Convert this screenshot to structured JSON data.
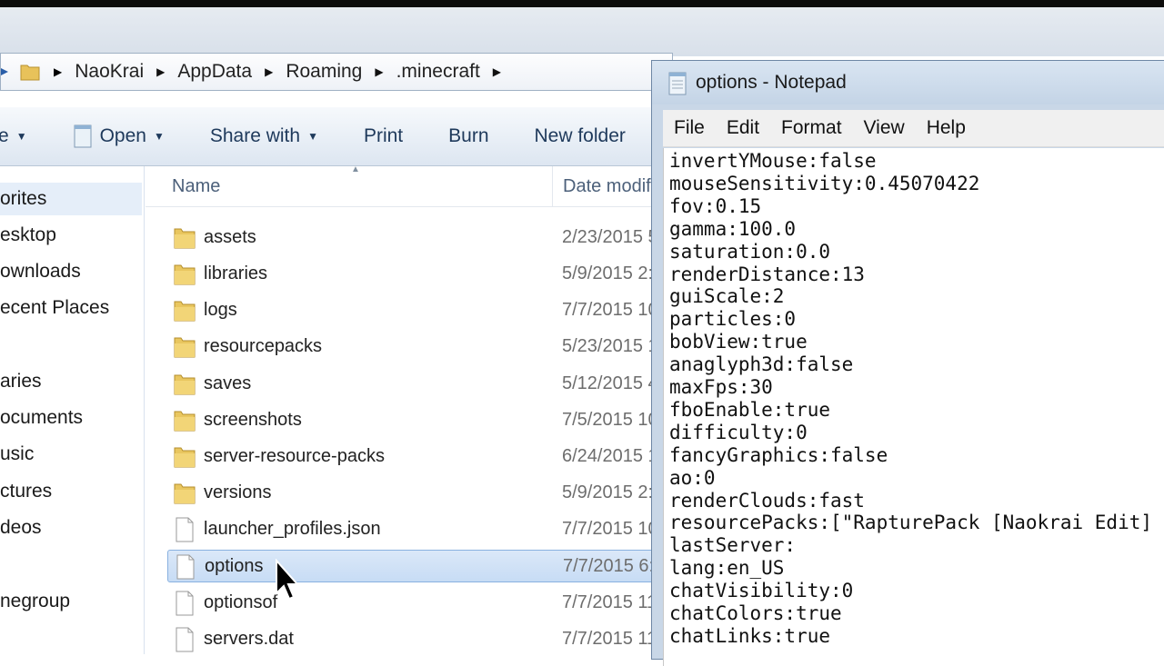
{
  "breadcrumb": [
    "NaoKrai",
    "AppData",
    "Roaming",
    ".minecraft"
  ],
  "toolbar": {
    "organize_partial": "e",
    "open_label": "Open",
    "share_label": "Share with",
    "print_label": "Print",
    "burn_label": "Burn",
    "new_folder_label": "New folder"
  },
  "nav": {
    "items": [
      "orites",
      "esktop",
      "ownloads",
      "ecent Places",
      "aries",
      "ocuments",
      "usic",
      "ctures",
      "deos",
      "negroup"
    ]
  },
  "columns": {
    "name": "Name",
    "date": "Date modif"
  },
  "files": [
    {
      "name": "assets",
      "date": "2/23/2015 5",
      "type": "folder"
    },
    {
      "name": "libraries",
      "date": "5/9/2015 2:",
      "type": "folder"
    },
    {
      "name": "logs",
      "date": "7/7/2015 10",
      "type": "folder"
    },
    {
      "name": "resourcepacks",
      "date": "5/23/2015 1",
      "type": "folder"
    },
    {
      "name": "saves",
      "date": "5/12/2015 4",
      "type": "folder"
    },
    {
      "name": "screenshots",
      "date": "7/5/2015 10",
      "type": "folder"
    },
    {
      "name": "server-resource-packs",
      "date": "6/24/2015 1",
      "type": "folder"
    },
    {
      "name": "versions",
      "date": "5/9/2015 2:",
      "type": "folder"
    },
    {
      "name": "launcher_profiles.json",
      "date": "7/7/2015 10",
      "type": "file"
    },
    {
      "name": "options",
      "date": "7/7/2015 6:",
      "type": "file"
    },
    {
      "name": "optionsof",
      "date": "7/7/2015 11",
      "type": "file"
    },
    {
      "name": "servers.dat",
      "date": "7/7/2015 11",
      "type": "file"
    }
  ],
  "notepad": {
    "title": "options - Notepad",
    "menu": [
      "File",
      "Edit",
      "Format",
      "View",
      "Help"
    ],
    "lines": [
      "invertYMouse:false",
      "mouseSensitivity:0.45070422",
      "fov:0.15",
      "gamma:100.0",
      "saturation:0.0",
      "renderDistance:13",
      "guiScale:2",
      "particles:0",
      "bobView:true",
      "anaglyph3d:false",
      "maxFps:30",
      "fboEnable:true",
      "difficulty:0",
      "fancyGraphics:false",
      "ao:0",
      "renderClouds:fast",
      "resourcePacks:[\"RapturePack [Naokrai Edit]",
      "lastServer:",
      "lang:en_US",
      "chatVisibility:0",
      "chatColors:true",
      "chatLinks:true"
    ]
  }
}
